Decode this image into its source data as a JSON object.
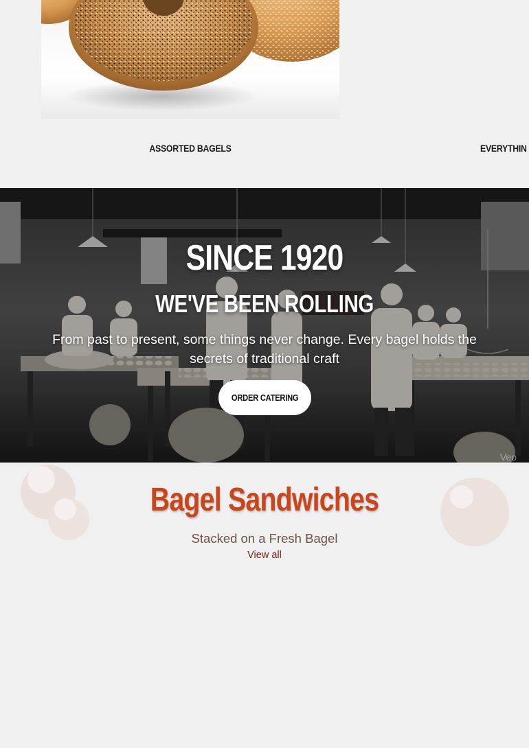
{
  "products": {
    "items": [
      {
        "name": "ASSORTED BAGELS",
        "image": "assorted-bagels-photo"
      },
      {
        "name": "EVERYTHIN",
        "image": "everything-bagel-photo"
      }
    ]
  },
  "hero": {
    "title": "SINCE 1920",
    "subtitle": "WE'VE BEEN ROLLING",
    "text": "From past to present, some things never change. Every bagel holds the secrets of traditional craft",
    "button_label": "ORDER CATERING",
    "watermark": "Veo",
    "background": "vintage-bakery-photo"
  },
  "sandwiches": {
    "title": "Bagel Sandwiches",
    "subtitle": "Stacked on a Fresh Bagel",
    "link_label": "View all"
  },
  "colors": {
    "page_background": "#f1f0f0",
    "accent": "#c8461b",
    "subtitle": "#6e5248",
    "link": "#7a1e12",
    "button_background": "#ffffff"
  }
}
